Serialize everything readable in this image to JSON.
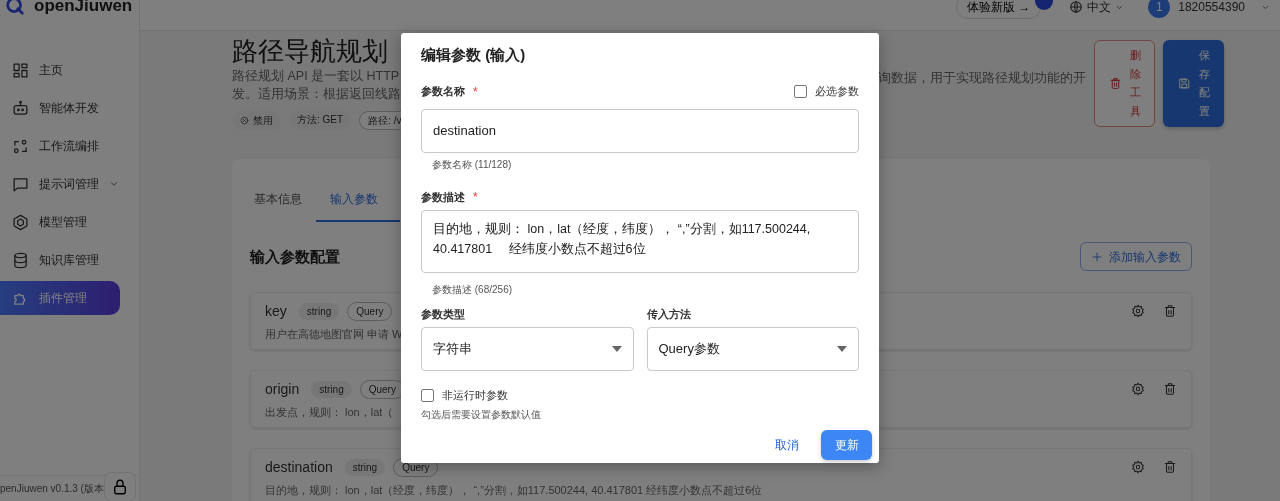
{
  "app": {
    "logo": "openJiuwen",
    "version": "penJiuwen v0.1.3 (版本"
  },
  "topbar": {
    "new_version": "体验新版",
    "arrow": "→",
    "language": "中文",
    "avatar": "1",
    "user": "1820554390"
  },
  "sidebar": {
    "items": [
      {
        "label": "主页",
        "kind": "grid",
        "submenu": false,
        "selected": false
      },
      {
        "label": "智能体开发",
        "kind": "robot",
        "submenu": false,
        "selected": false
      },
      {
        "label": "工作流编排",
        "kind": "flow",
        "submenu": false,
        "selected": false
      },
      {
        "label": "提示词管理",
        "kind": "chat",
        "submenu": true,
        "selected": false
      },
      {
        "label": "模型管理",
        "kind": "hex",
        "submenu": false,
        "selected": false
      },
      {
        "label": "知识库管理",
        "kind": "db",
        "submenu": false,
        "selected": false
      },
      {
        "label": "插件管理",
        "kind": "plugin",
        "submenu": false,
        "selected": true
      }
    ]
  },
  "tool": {
    "title": "路径导航规划",
    "description_left": [
      "路径规划 API 是一套以 HTTP",
      "发。适用场景：根据返回线路"
    ],
    "description_right": "询数据，用于实现路径规划功能的开",
    "tags": [
      {
        "kind": "status",
        "label": "禁用"
      },
      {
        "kind": "method",
        "label": "方法: GET"
      },
      {
        "kind": "path",
        "label": "路径: /v"
      }
    ],
    "delete_button": "删除工具",
    "save_button": "保存配置"
  },
  "tabs": [
    {
      "label": "基本信息",
      "selected": false
    },
    {
      "label": "输入参数",
      "selected": true
    }
  ],
  "section": {
    "heading": "输入参数配置",
    "add_button": "添加输入参数"
  },
  "params": [
    {
      "name": "key",
      "type": "string",
      "method": "Query",
      "description": "用户在高德地图官网 申请 W"
    },
    {
      "name": "origin",
      "type": "string",
      "method": "Query",
      "description": "出发点，规则： lon，lat（"
    },
    {
      "name": "destination",
      "type": "string",
      "method": "Query",
      "description": "目的地，规则： lon，lat（经度，纬度）， “,”分割，如117.500244, 40.417801 经纬度小数点不超过6位"
    }
  ],
  "modal": {
    "title": "编辑参数 (输入)",
    "required_mark": "*",
    "name_label": "参数名称",
    "name_required": true,
    "required_checkbox": {
      "label": "必选参数",
      "checked": false
    },
    "name_value": "destination",
    "name_help": "参数名称 (11/128)",
    "desc_label": "参数描述",
    "desc_required": true,
    "desc_value": "目的地，规则： lon，lat（经度，纬度）， “,”分割，如117.500244, 40.417801　 经纬度小数点不超过6位",
    "desc_help": "参数描述 (68/256)",
    "type_label": "参数类型",
    "type_value": "字符串",
    "method_label": "传入方法",
    "method_value": "Query参数",
    "runtime_checkbox": {
      "label": "非运行时参数",
      "checked": false
    },
    "runtime_help": "勾选后需要设置参数默认值",
    "cancel": "取消",
    "submit": "更新"
  }
}
